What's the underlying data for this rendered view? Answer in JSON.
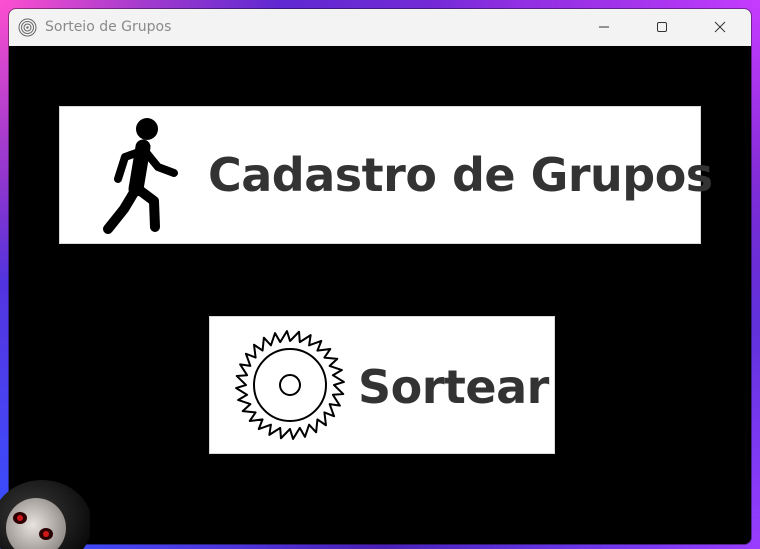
{
  "window": {
    "title": "Sorteio de Grupos",
    "app_icon": "target-icon",
    "controls": {
      "minimize_icon": "minimize-icon",
      "maximize_icon": "maximize-icon",
      "close_icon": "close-icon"
    }
  },
  "main": {
    "buttons": [
      {
        "label": "Cadastro de Grupos",
        "icon": "walking-person-icon"
      },
      {
        "label": "Sortear",
        "icon": "saw-blade-icon"
      }
    ]
  },
  "colors": {
    "content_background": "#000000",
    "button_background": "#ffffff",
    "button_text": "#333333",
    "titlebar": "#f3f3f3",
    "title_text": "#8a8a8a"
  }
}
